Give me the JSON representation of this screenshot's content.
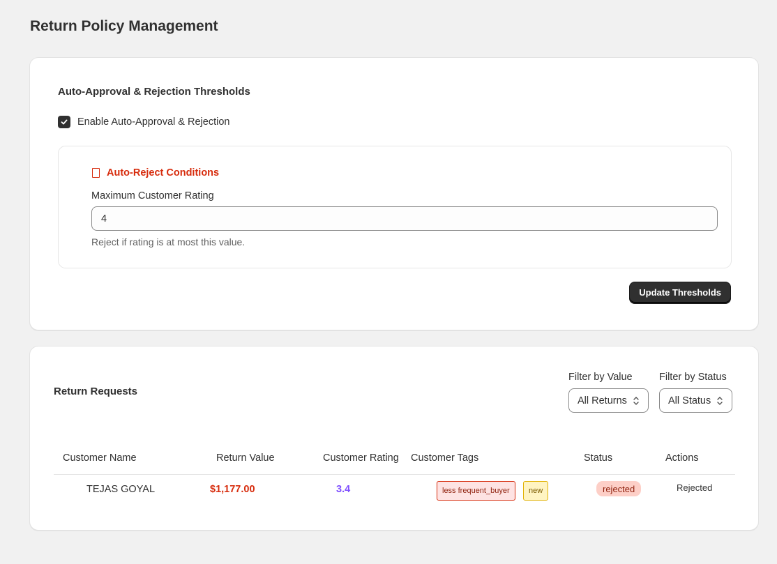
{
  "page": {
    "title": "Return Policy Management"
  },
  "thresholds": {
    "title": "Auto-Approval & Rejection Thresholds",
    "enable_label": "Enable Auto-Approval & Rejection",
    "enabled": true,
    "reject": {
      "title": "Auto-Reject Conditions",
      "field_label": "Maximum Customer Rating",
      "field_value": "4",
      "help": "Reject if rating is at most this value."
    },
    "update_button": "Update Thresholds"
  },
  "requests": {
    "title": "Return Requests",
    "filters": [
      {
        "label": "Filter by Value",
        "selected": "All Returns"
      },
      {
        "label": "Filter by Status",
        "selected": "All Status"
      }
    ],
    "columns": [
      "Customer Name",
      "Return Value",
      "Customer Rating",
      "Customer Tags",
      "Status",
      "Actions"
    ],
    "rows": [
      {
        "name": "TEJAS GOYAL",
        "value": "$1,177.00",
        "rating": "3.4",
        "tags": [
          "less frequent_buyer",
          "new"
        ],
        "status": "rejected",
        "action": "Rejected"
      }
    ]
  },
  "colors": {
    "accent_dark": "#303030",
    "danger": "#d72c0d",
    "rating": "#8051ff",
    "background": "#f1f1f1"
  },
  "icons": [
    "checkmark-icon",
    "document-icon",
    "chevron-updown-icon"
  ]
}
